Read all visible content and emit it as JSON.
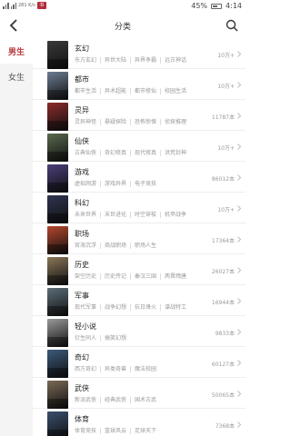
{
  "status": {
    "network": "281\nK/s",
    "app_badge": "书",
    "battery": "45%",
    "time": "4:14"
  },
  "header": {
    "title": "分类"
  },
  "sidebar": {
    "items": [
      {
        "label": "男生",
        "active": true
      },
      {
        "label": "女生",
        "active": false
      }
    ]
  },
  "categories": [
    {
      "name": "玄幻",
      "tags": [
        "东方玄幻",
        "异世大陆",
        "异界争霸",
        "远古神话"
      ],
      "count": "10万+",
      "color": "#3a3a3a"
    },
    {
      "name": "都市",
      "tags": [
        "都市生活",
        "异术超能",
        "都市修仙",
        "校园生活"
      ],
      "count": "10万+",
      "color": "#6c7d92"
    },
    {
      "name": "灵异",
      "tags": [
        "灵异神怪",
        "悬疑探险",
        "恐怖惊悚",
        "侦探推理"
      ],
      "count": "11787本",
      "color": "#8c2b2b"
    },
    {
      "name": "仙侠",
      "tags": [
        "古典仙侠",
        "奇幻修真",
        "现代修真",
        "洪荒封神"
      ],
      "count": "10万+",
      "color": "#5a6a4e"
    },
    {
      "name": "游戏",
      "tags": [
        "虚拟网游",
        "游戏异界",
        "电子竞技"
      ],
      "count": "86012本",
      "color": "#4b3f7a"
    },
    {
      "name": "科幻",
      "tags": [
        "未来世界",
        "末世进化",
        "时空穿梭",
        "机甲战争"
      ],
      "count": "10万+",
      "color": "#2f3450"
    },
    {
      "name": "职场",
      "tags": [
        "官海沉浮",
        "商战职场",
        "职场人生"
      ],
      "count": "17364本",
      "color": "#b5462d"
    },
    {
      "name": "历史",
      "tags": [
        "架空历史",
        "历史传记",
        "秦汉三国",
        "两晋隋唐"
      ],
      "count": "26027本",
      "color": "#8a7658"
    },
    {
      "name": "军事",
      "tags": [
        "现代军事",
        "战争幻想",
        "抗日烽火",
        "谍战特工"
      ],
      "count": "16944本",
      "color": "#5d6e78"
    },
    {
      "name": "轻小说",
      "tags": [
        "衍生同人",
        "搞笑幻想"
      ],
      "count": "9833本",
      "color": "#9a9a9a"
    },
    {
      "name": "奇幻",
      "tags": [
        "西方奇幻",
        "异类奇兽",
        "魔法校园"
      ],
      "count": "60127本",
      "color": "#3c5a7a"
    },
    {
      "name": "武侠",
      "tags": [
        "新派武侠",
        "经典武侠",
        "国术古武"
      ],
      "count": "50065本",
      "color": "#7a6a55"
    },
    {
      "name": "体育",
      "tags": [
        "体育竞技",
        "篮球风云",
        "足球天下"
      ],
      "count": "7368本",
      "color": "#3a4f6e"
    }
  ]
}
